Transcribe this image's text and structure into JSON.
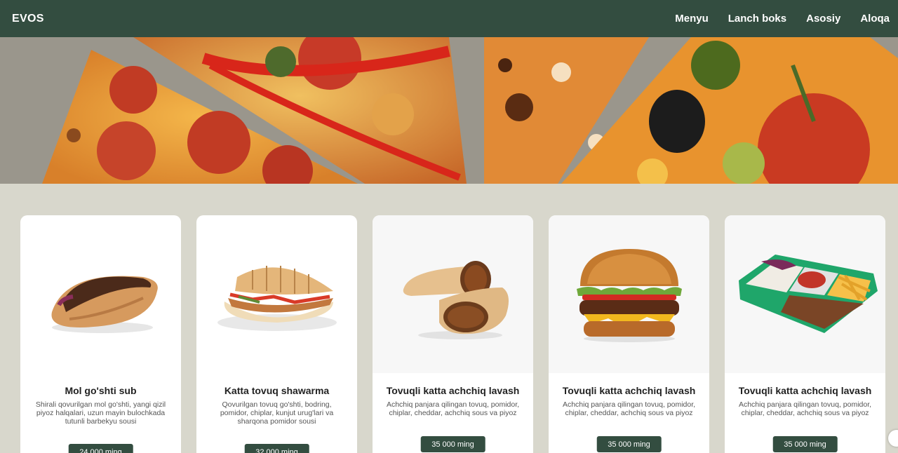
{
  "header": {
    "logo": "EVOS",
    "nav": [
      {
        "label": "Menyu"
      },
      {
        "label": "Lanch boks"
      },
      {
        "label": "Asosiy"
      },
      {
        "label": "Aloqa"
      }
    ]
  },
  "hero": {
    "image": "pizza-slices-banner"
  },
  "products": [
    {
      "title": "Mol go'shti sub",
      "description": "Shirali qovurilgan mol go'shti, yangi qizil piyoz halqalari, uzun mayin bulochkada tutunli barbekyu sousi",
      "price": "24 000 ming",
      "image": "beef-sub-icon"
    },
    {
      "title": "Katta tovuq shawarma",
      "description": "Qovurilgan tovuq go'shti, bodring, pomidor, chiplar, kunjut urug'lari va sharqona pomidor sousi",
      "price": "32 000 ming",
      "image": "shawarma-icon"
    },
    {
      "title": "Tovuqli katta achchiq lavash",
      "description": "Achchiq panjara qilingan tovuq, pomidor, chiplar, cheddar, achchiq sous va piyoz",
      "price": "35 000 ming",
      "image": "lavash-icon"
    },
    {
      "title": "Tovuqli katta achchiq lavash",
      "description": "Achchiq panjara qilingan tovuq, pomidor, chiplar, cheddar, achchiq sous va piyoz",
      "price": "35 000 ming",
      "image": "burger-icon"
    },
    {
      "title": "Tovuqli katta achchiq lavash",
      "description": "Achchiq panjara qilingan tovuq, pomidor, chiplar, cheddar, achchiq sous va piyoz",
      "price": "35 000 ming",
      "image": "lunch-box-icon"
    }
  ],
  "colors": {
    "nav_bg": "#334d40",
    "page_bg": "#d8d7cc",
    "button_bg": "#334d40"
  }
}
